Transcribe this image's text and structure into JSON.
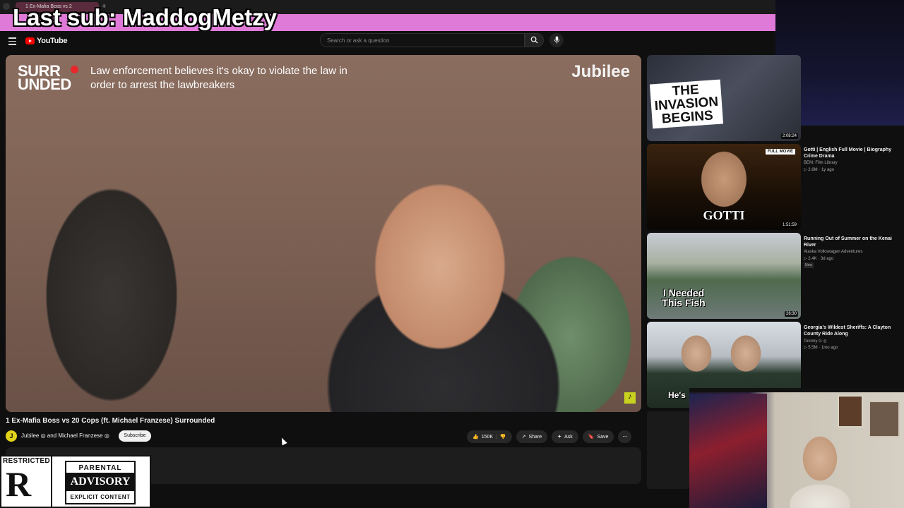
{
  "browser": {
    "tab_title": "1 Ex-Mafia Boss vs 2"
  },
  "banner": {
    "text": "Last sub: MaddogMetzy"
  },
  "header": {
    "logo_text": "YouTube",
    "search_placeholder": "Search or ask a question"
  },
  "video": {
    "brand": "SURR\nUNDED",
    "caption": "Law enforcement believes it's okay to violate the law in order to arrest the lawbreakers",
    "watermark": "Jubilee",
    "title": "1 Ex-Mafia Boss vs 20 Cops (ft. Michael Franzese) Surrounded",
    "channel": "Jubilee ◎ and Michael Franzese ◎",
    "subscribe_label": "Subscribe",
    "likes": "150K",
    "share_label": "Share",
    "ask_label": "Ask",
    "save_label": "Save"
  },
  "recommendations": [
    {
      "thumb_text": "THE INVASION BEGINS",
      "duration": "2:08:24",
      "title": "",
      "channel": "",
      "meta": ""
    },
    {
      "thumb_text": "GOTTI",
      "badge": "FULL MOVIE",
      "duration": "1:51:59",
      "title": "Gotti | English Full Movie | Biography Crime Drama",
      "channel": "BEM: Film Library",
      "meta": "▷ 2.6M · 1y ago"
    },
    {
      "thumb_text": "I Needed This Fish",
      "duration": "26:30",
      "title": "Running Out of Summer on the Kenai River",
      "channel": "Alaska Volkswagen Adventures",
      "meta": "▷ 2.4K · 3d ago",
      "new": "New"
    },
    {
      "thumb_text": "He's",
      "duration": "",
      "title": "Georgia's Wildest Sheriffs: A Clayton County Ride Along",
      "channel": "Tommy G ◎",
      "meta": "▷ 5.5M · 1mo ago"
    }
  ],
  "restricted": {
    "header": "RESTRICTED",
    "letter": "R",
    "pa_top": "PARENTAL",
    "pa_mid": "ADVISORY",
    "pa_bot": "EXPLICIT CONTENT"
  }
}
